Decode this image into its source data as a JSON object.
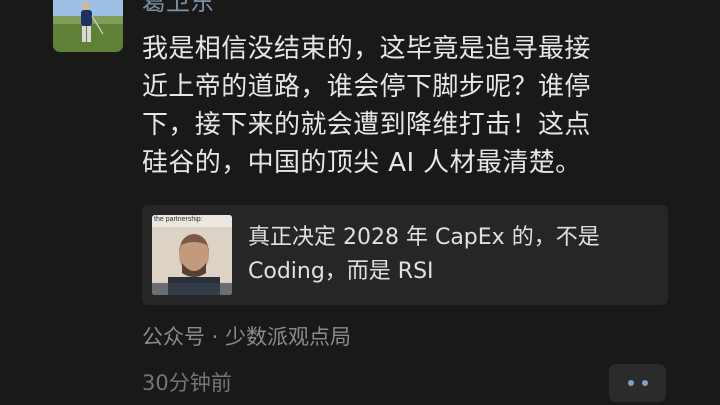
{
  "post": {
    "author_name": "葛卫东",
    "lines": [
      "我是相信没结束的，这毕竟是追寻最接",
      "近上帝的道路，谁会停下脚步呢？谁停",
      "下，接下来的就会遭到降维打击！这点",
      "硅谷的，中国的顶尖 AI 人材最清楚。"
    ]
  },
  "link_card": {
    "thumb_caption": "the partnership:",
    "title_lines": [
      "真正决定 2028 年 CapEx 的，不是",
      "Coding，而是 RSI"
    ]
  },
  "source": "公众号 · 少数派观点局",
  "timestamp": "30分钟前",
  "icons": {
    "more": "more-dots-icon",
    "avatar": "golfer-avatar"
  },
  "colors": {
    "background": "#191919",
    "author_name": "#7d90a8",
    "body_text": "#e6e6e6",
    "card_background": "#262626",
    "meta_text": "#8a8a8a"
  }
}
